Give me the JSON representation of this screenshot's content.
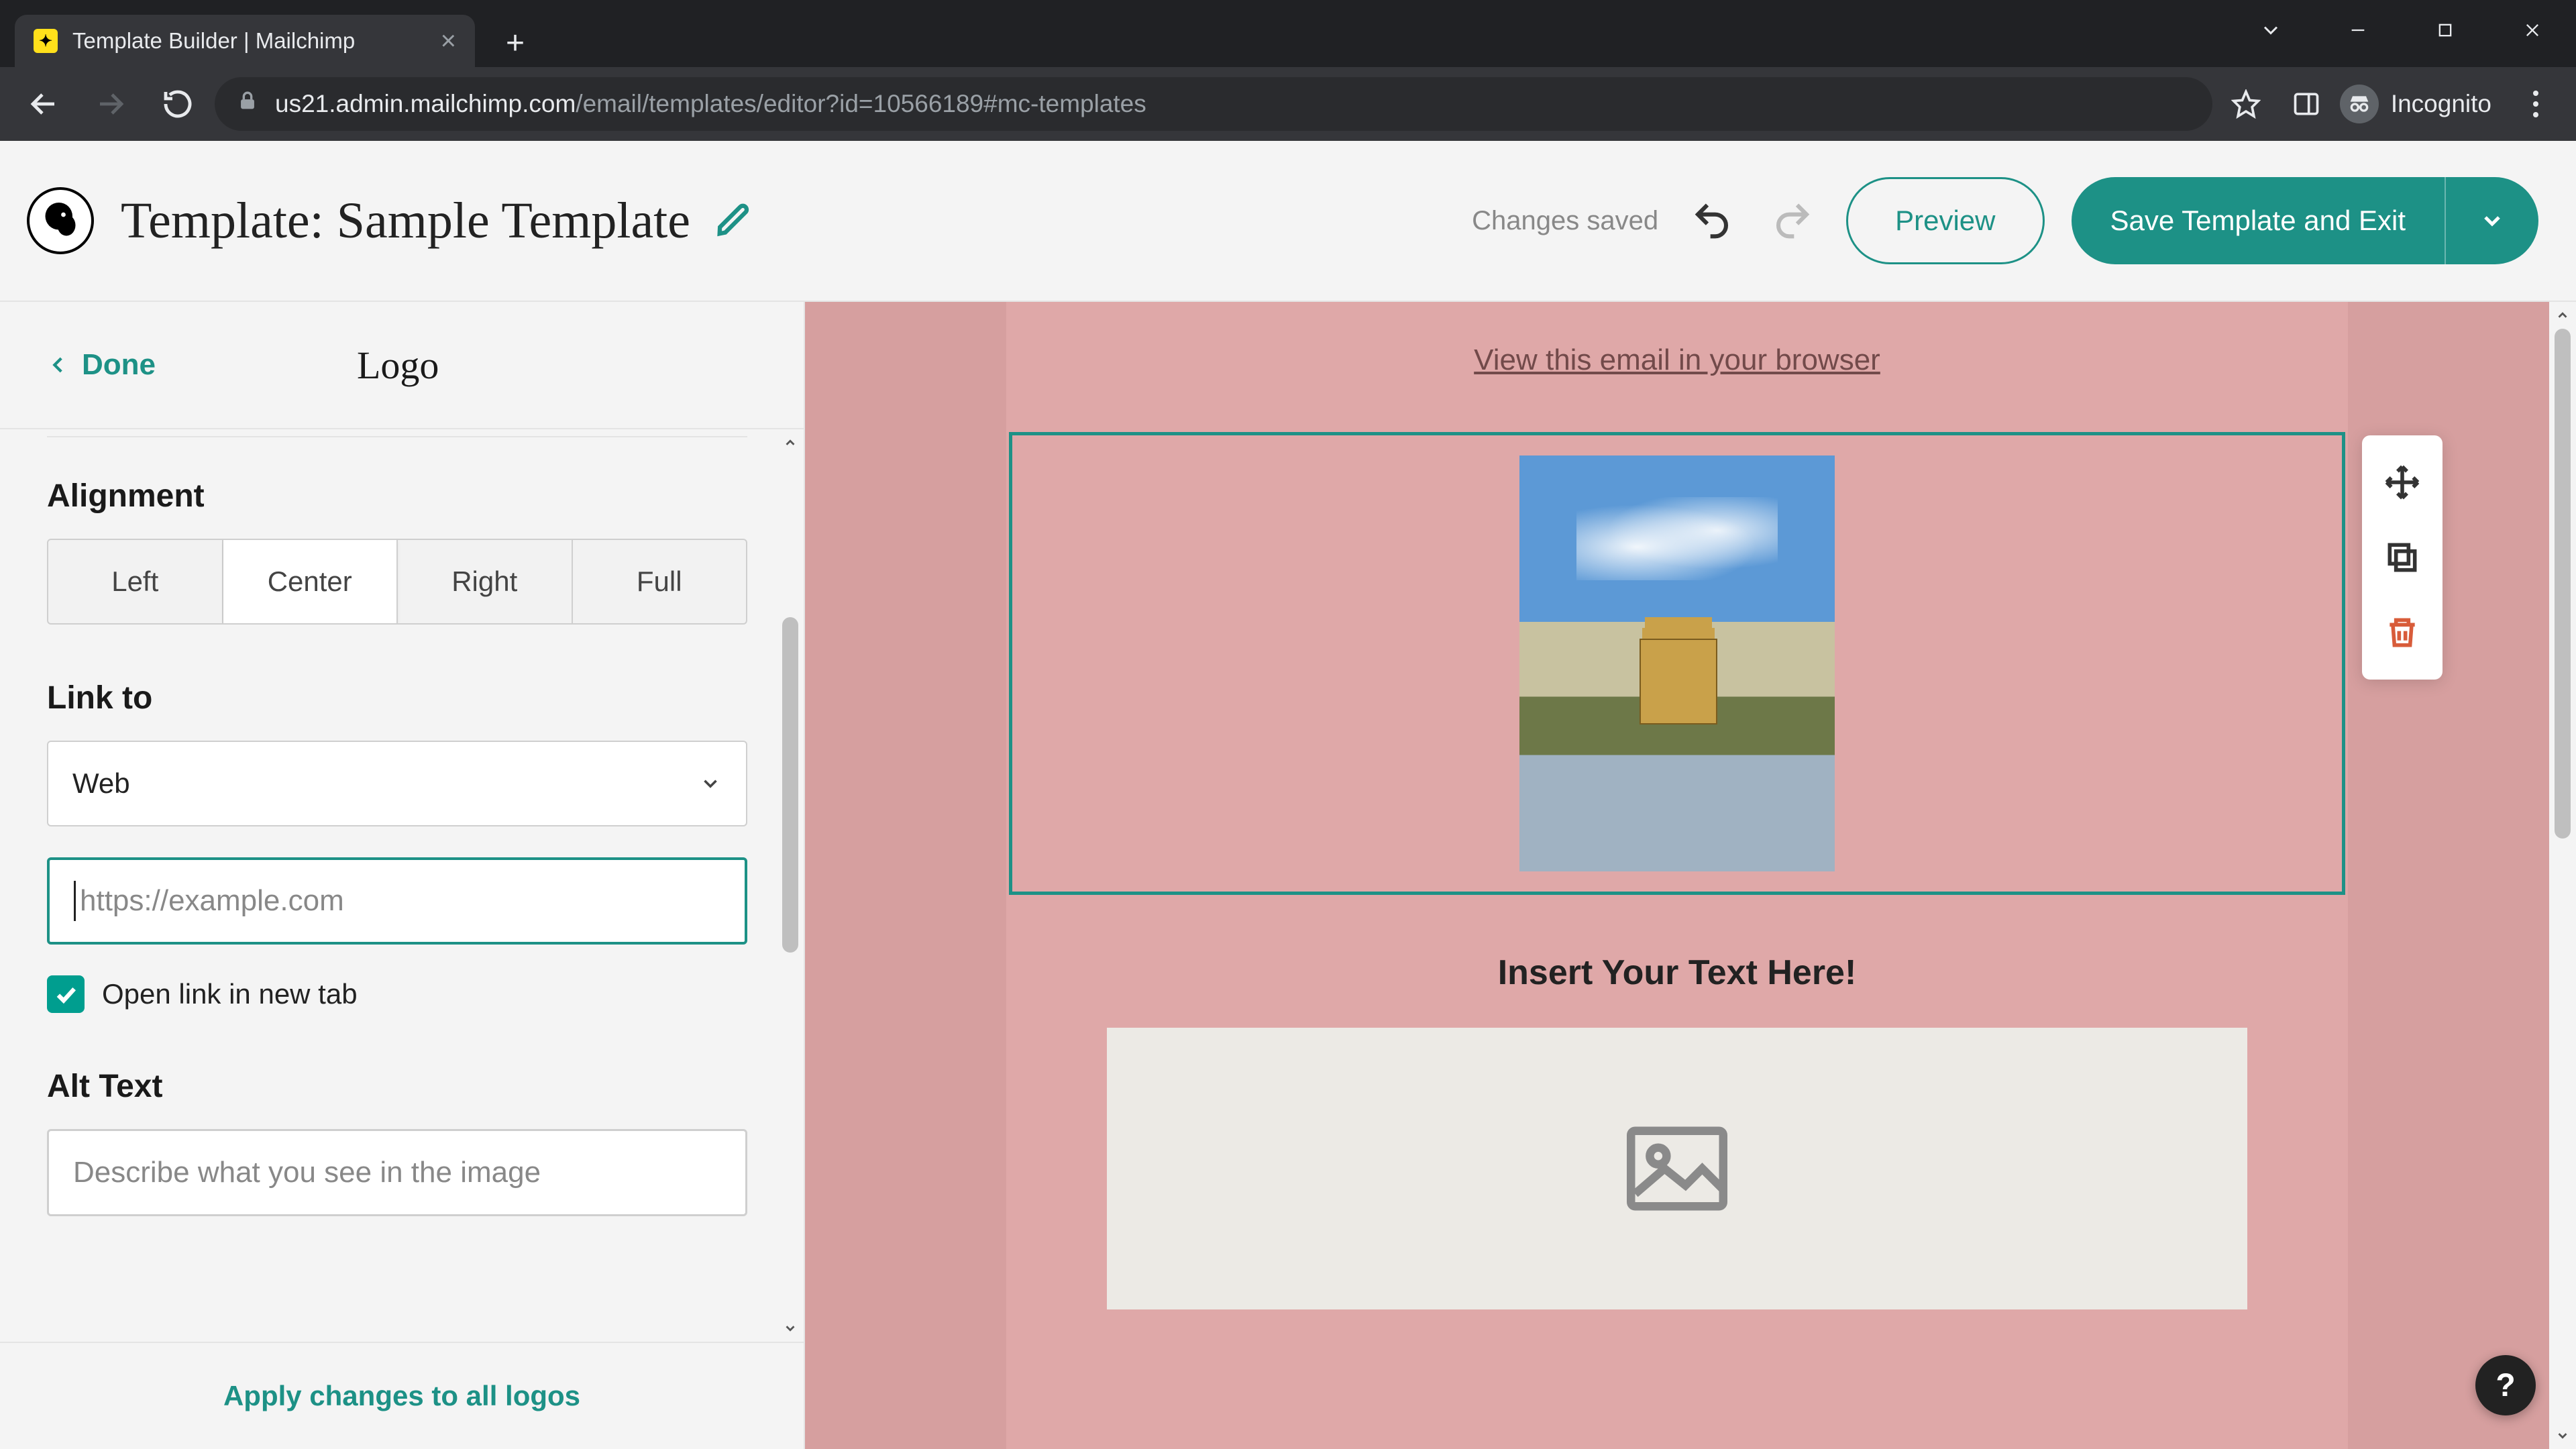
{
  "browser": {
    "tab_title": "Template Builder | Mailchimp",
    "url_host": "us21.admin.mailchimp.com",
    "url_path": "/email/templates/editor?id=10566189#mc-templates",
    "incognito_label": "Incognito"
  },
  "topbar": {
    "template_title": "Template: Sample Template",
    "changes_saved": "Changes saved",
    "preview_label": "Preview",
    "save_exit_label": "Save Template and Exit"
  },
  "panel": {
    "back_label": "Done",
    "title": "Logo",
    "alignment": {
      "label": "Alignment",
      "options": [
        "Left",
        "Center",
        "Right",
        "Full"
      ],
      "selected": "Center"
    },
    "link_to": {
      "label": "Link to",
      "select_value": "Web",
      "url_value": "",
      "url_placeholder": "https://example.com",
      "open_new_tab_label": "Open link in new tab",
      "open_new_tab_checked": true
    },
    "alt_text": {
      "label": "Alt Text",
      "value": "",
      "placeholder": "Describe what you see in the image"
    },
    "footer_action": "Apply changes to all logos"
  },
  "canvas": {
    "view_in_browser": "View this email in your browser",
    "heading_text": "Insert Your Text Here!"
  },
  "help": {
    "label": "?"
  }
}
